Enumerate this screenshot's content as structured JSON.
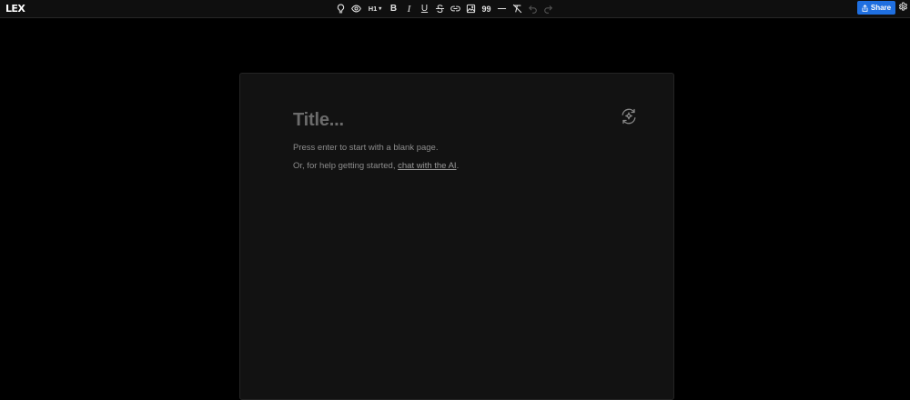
{
  "app": {
    "logo_text": "LEX"
  },
  "toolbar": {
    "items": [
      {
        "icon": "lightbulb-icon"
      },
      {
        "icon": "eye-icon"
      },
      {
        "label": "H1",
        "icon": "chevron-down-icon"
      },
      {
        "label": "B"
      },
      {
        "label": "I"
      },
      {
        "label": "U"
      },
      {
        "icon": "strikethrough-icon"
      },
      {
        "icon": "link-icon"
      },
      {
        "icon": "image-icon"
      },
      {
        "label": "99"
      },
      {
        "icon": "horizontal-rule-icon"
      },
      {
        "icon": "clear-formatting-icon"
      },
      {
        "icon": "undo-icon"
      },
      {
        "icon": "redo-icon"
      }
    ],
    "heading_label": "H1",
    "bold_label": "B",
    "italic_label": "I",
    "underline_label": "U",
    "quote_label": "99",
    "share_label": "Share",
    "share_color": "#1f6fe0"
  },
  "editor": {
    "title_placeholder": "Title...",
    "hint_line1": "Press enter to start with a blank page.",
    "hint_line2_prefix": "Or, for help getting started, ",
    "hint_line2_link": "chat with the AI",
    "hint_line2_suffix": "."
  }
}
